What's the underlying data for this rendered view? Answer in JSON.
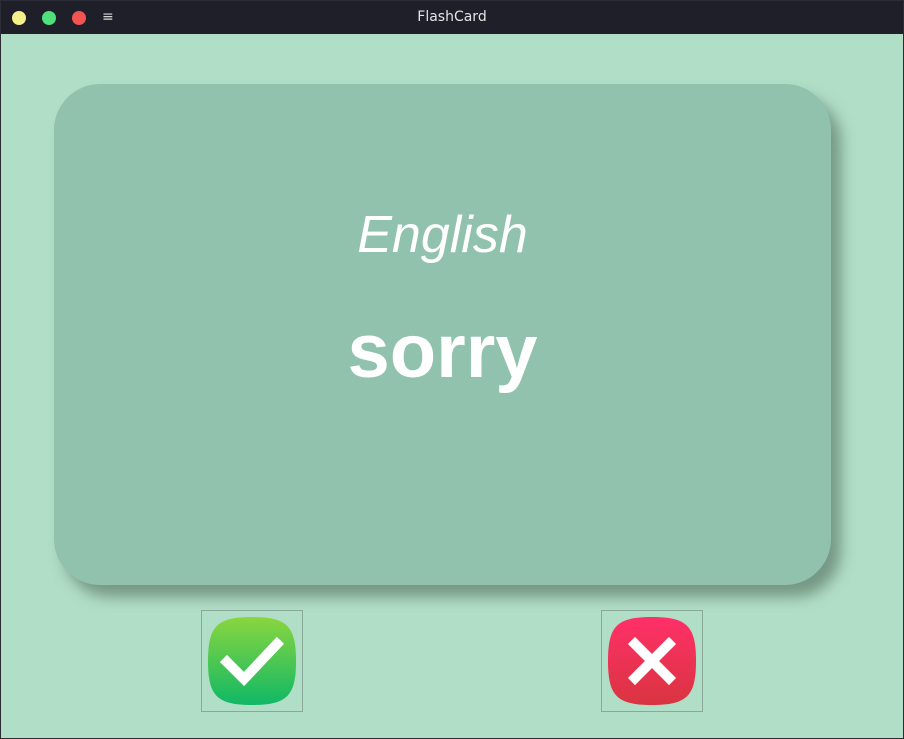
{
  "window": {
    "title": "FlashCard",
    "menu_glyph": "≡",
    "controls": {
      "minimize_color": "#f5f08a",
      "maximize_color": "#4ee07a",
      "close_color": "#f25454"
    }
  },
  "card": {
    "language": "English",
    "word": "sorry",
    "background_color": "#91c2ae"
  },
  "buttons": {
    "right": {
      "icon": "checkmark-icon",
      "gradient": [
        "#8ad63e",
        "#10b866"
      ]
    },
    "wrong": {
      "icon": "cross-icon",
      "gradient": [
        "#ff3069",
        "#d93440"
      ]
    }
  },
  "colors": {
    "background": "#b1dec6",
    "titlebar": "#1f1f2a"
  }
}
